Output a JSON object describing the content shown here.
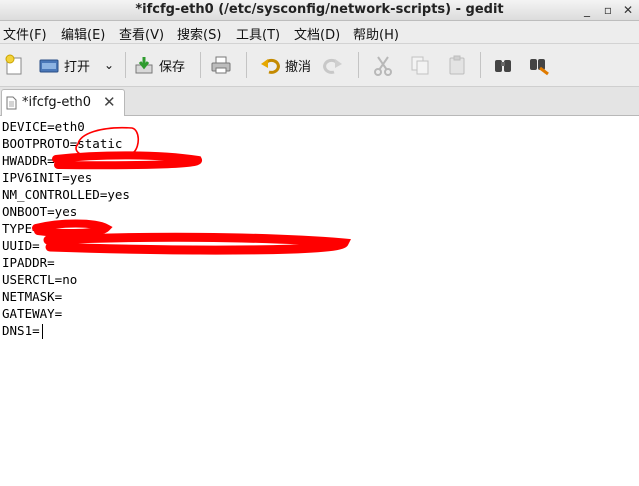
{
  "window": {
    "title": "*ifcfg-eth0 (/etc/sysconfig/network-scripts) - gedit"
  },
  "menubar": {
    "items": [
      "文件(F)",
      "编辑(E)",
      "查看(V)",
      "搜索(S)",
      "工具(T)",
      "文档(D)",
      "帮助(H)"
    ]
  },
  "toolbar": {
    "open_label": "打开",
    "save_label": "保存",
    "undo_label": "撤消"
  },
  "tab": {
    "label": "*ifcfg-eth0"
  },
  "editor": {
    "lines": [
      "DEVICE=eth0",
      "BOOTPROTO=static",
      "HWADDR=",
      "IPV6INIT=yes",
      "NM_CONTROLLED=yes",
      "ONBOOT=yes",
      "TYPE=",
      "UUID=",
      "IPADDR=",
      "USERCTL=no",
      "NETMASK=",
      "GATEWAY=",
      "DNS1="
    ]
  },
  "annotation_color": "#ff0000"
}
